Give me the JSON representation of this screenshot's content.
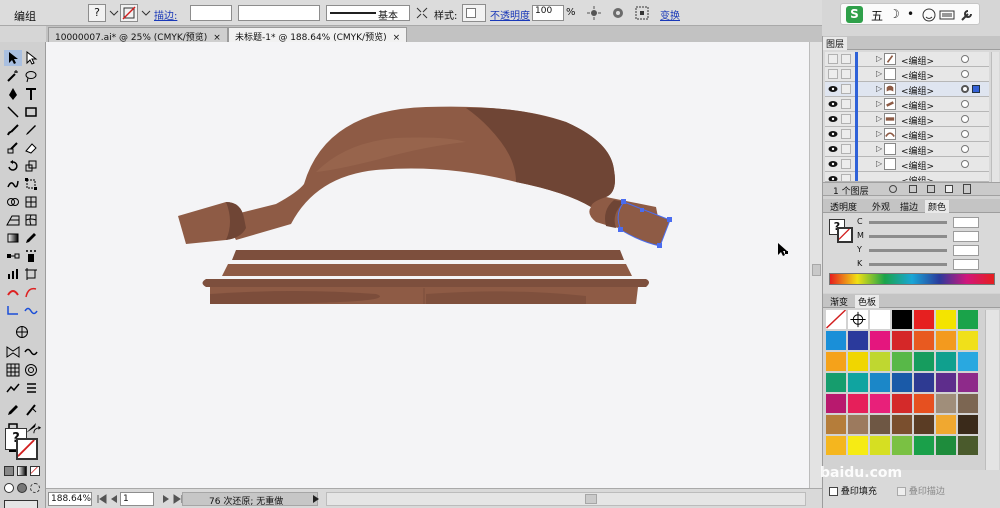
{
  "control_bar": {
    "selection_label": "编组",
    "fill_label": "?",
    "stroke_link": "描边:",
    "stroke_profile_label": "基本",
    "style_label": "样式:",
    "opacity_link": "不透明度",
    "opacity_value": "100",
    "opacity_unit": "%",
    "transform_link": "变换"
  },
  "ime": {
    "logo": "S",
    "mode": "五",
    "moon": "☽",
    "dot": "•"
  },
  "tabs": [
    {
      "label": "10000007.ai* @ 25% (CMYK/预览)",
      "close": "×"
    },
    {
      "label": "未标题-1* @ 188.64% (CMYK/预览)",
      "close": "×"
    }
  ],
  "status_bar": {
    "zoom": "188.64%",
    "page": "1",
    "undo_text": "76 次还原; 无重做"
  },
  "layers_panel": {
    "title": "图层",
    "rows": [
      {
        "name": "<编组>",
        "visible": false
      },
      {
        "name": "<编组>",
        "visible": false
      },
      {
        "name": "<编组>",
        "visible": true,
        "selected": true
      },
      {
        "name": "<编组>",
        "visible": true
      },
      {
        "name": "<编组>",
        "visible": true
      },
      {
        "name": "<编组>",
        "visible": true
      },
      {
        "name": "<编组>",
        "visible": true
      },
      {
        "name": "<编组>",
        "visible": true
      },
      {
        "name": "<编组>",
        "visible": true
      }
    ],
    "footer_count": "1 个图层"
  },
  "color_panel": {
    "tabs": [
      "透明度",
      "外观",
      "描边",
      "颜色"
    ],
    "active_tab": "颜色",
    "channels": [
      "C",
      "M",
      "Y",
      "K"
    ],
    "fill_label": "?"
  },
  "swatches_panel": {
    "tabs": [
      "渐变",
      "色板"
    ],
    "active_tab": "色板",
    "colors": [
      "none",
      "#ffffff",
      "#ffffff",
      "#000000",
      "#e62020",
      "#f4e400",
      "#1aa34a",
      "#1a8fd8",
      "#2b3a9c",
      "#e4167e",
      "#d52728",
      "#e85a20",
      "#f39a1e",
      "#f0e01a",
      "#f5a21a",
      "#f0d600",
      "#bfd730",
      "#58b848",
      "#169c5e",
      "#10a08e",
      "#29a8e0",
      "#169d6d",
      "#10a4a0",
      "#1b87c8",
      "#1a5aa8",
      "#2e3a92",
      "#5e2d8c",
      "#8e2a8a",
      "#b8196e",
      "#e61f5a",
      "#e8207a",
      "#d42a2a",
      "#e65020",
      "#a08e7a",
      "#7c6652",
      "#b57d3a",
      "#9c7a5e",
      "#6e5744",
      "#7a4f2e",
      "#5a3c24",
      "#f0a830",
      "#3a2a1a",
      "#f5b61e",
      "#f6eb14",
      "#d6df22",
      "#7ac143",
      "#1aa04a",
      "#1e8c3c",
      "#4a5a2c"
    ],
    "options": [
      {
        "label": "叠印填充"
      },
      {
        "label": "叠印描边"
      }
    ]
  },
  "watermark": "baidu.com",
  "artwork_colors": {
    "main": "#8e5b45",
    "dark": "#6f4535",
    "mid": "#7d4f3d",
    "light": "#9c6a52",
    "selection": "#4a6cf0"
  }
}
